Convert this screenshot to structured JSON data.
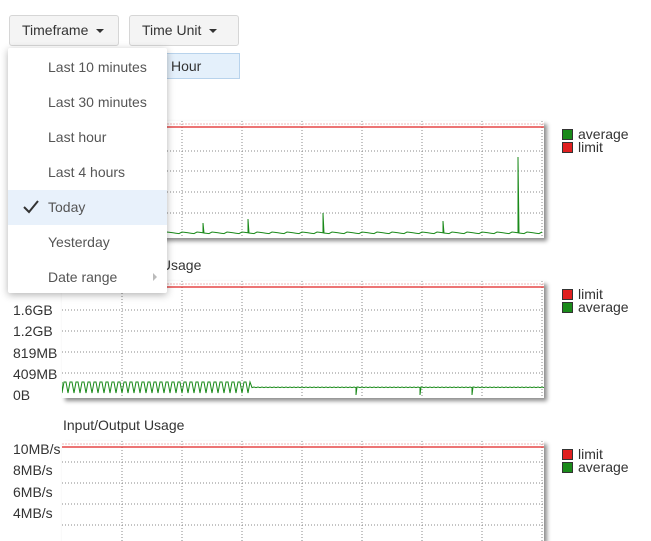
{
  "toolbar": {
    "timeframe_label": "Timeframe",
    "time_unit_label": "Time Unit",
    "selected_unit": "Hour"
  },
  "timeframe_menu": {
    "items": [
      {
        "label": "Last 10 minutes",
        "selected": false
      },
      {
        "label": "Last 30 minutes",
        "selected": false
      },
      {
        "label": "Last hour",
        "selected": false
      },
      {
        "label": "Last 4 hours",
        "selected": false
      },
      {
        "label": "Today",
        "selected": true
      },
      {
        "label": "Yesterday",
        "selected": false
      },
      {
        "label": "Date range",
        "selected": false,
        "has_submenu": true
      }
    ]
  },
  "colors": {
    "average": "#1a8a1a",
    "limit": "#e02020",
    "selected_bg": "#e8f1fb"
  },
  "charts": {
    "cpu": {
      "legend": [
        "average",
        "limit"
      ]
    },
    "memory": {
      "title": "Memory Usage",
      "title_visible": "y Usage",
      "y_labels": [
        "1.6GB",
        "1.2GB",
        "819MB",
        "409MB",
        "0B"
      ],
      "legend": [
        "limit",
        "average"
      ]
    },
    "io": {
      "title": "Input/Output Usage",
      "y_labels": [
        "10MB/s",
        "8MB/s",
        "6MB/s",
        "4MB/s"
      ],
      "legend": [
        "limit",
        "average"
      ]
    }
  }
}
